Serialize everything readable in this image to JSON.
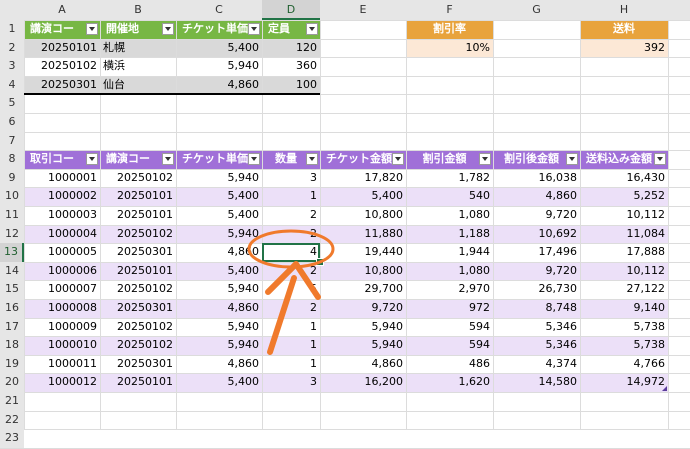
{
  "columns": [
    "A",
    "B",
    "C",
    "D",
    "E",
    "F",
    "G",
    "H"
  ],
  "rows": [
    "1",
    "2",
    "3",
    "4",
    "5",
    "6",
    "7",
    "8",
    "9",
    "10",
    "11",
    "12",
    "13",
    "14",
    "15",
    "16",
    "17",
    "18",
    "19",
    "20",
    "21",
    "22",
    "23"
  ],
  "colors": {
    "green_header": "#77b744",
    "gray_band": "#d9d9d9",
    "purple_header": "#a070d8",
    "purple_band": "#ece0f8",
    "orange_header": "#e8a33c",
    "peach_fill": "#fce8d6",
    "annotation": "#f07a2c",
    "selection": "#217346"
  },
  "table_top": {
    "headers": [
      "講演コー",
      "開催地",
      "チケット単価",
      "定員"
    ],
    "rows": [
      [
        "20250101",
        "札幌",
        "5,400",
        "120"
      ],
      [
        "20250102",
        "横浜",
        "5,940",
        "360"
      ],
      [
        "20250301",
        "仙台",
        "4,860",
        "100"
      ]
    ]
  },
  "discount": {
    "label": "割引率",
    "value": "10%"
  },
  "shipping": {
    "label": "送料",
    "value": "392"
  },
  "table_main": {
    "headers": [
      "取引コー",
      "講演コー",
      "チケット単価",
      "数量",
      "チケット金額",
      "割引金額",
      "割引後金額",
      "送料込み金額"
    ],
    "rows": [
      [
        "1000001",
        "20250102",
        "5,940",
        "3",
        "17,820",
        "1,782",
        "16,038",
        "16,430"
      ],
      [
        "1000002",
        "20250101",
        "5,400",
        "1",
        "5,400",
        "540",
        "4,860",
        "5,252"
      ],
      [
        "1000003",
        "20250101",
        "5,400",
        "2",
        "10,800",
        "1,080",
        "9,720",
        "10,112"
      ],
      [
        "1000004",
        "20250102",
        "5,940",
        "2",
        "11,880",
        "1,188",
        "10,692",
        "11,084"
      ],
      [
        "1000005",
        "20250301",
        "4,860",
        "4",
        "19,440",
        "1,944",
        "17,496",
        "17,888"
      ],
      [
        "1000006",
        "20250101",
        "5,400",
        "2",
        "10,800",
        "1,080",
        "9,720",
        "10,112"
      ],
      [
        "1000007",
        "20250102",
        "5,940",
        "5",
        "29,700",
        "2,970",
        "26,730",
        "27,122"
      ],
      [
        "1000008",
        "20250301",
        "4,860",
        "2",
        "9,720",
        "972",
        "8,748",
        "9,140"
      ],
      [
        "1000009",
        "20250102",
        "5,940",
        "1",
        "5,940",
        "594",
        "5,346",
        "5,738"
      ],
      [
        "1000010",
        "20250102",
        "5,940",
        "1",
        "5,940",
        "594",
        "5,346",
        "5,738"
      ],
      [
        "1000011",
        "20250301",
        "4,860",
        "1",
        "4,860",
        "486",
        "4,374",
        "4,766"
      ],
      [
        "1000012",
        "20250101",
        "5,400",
        "3",
        "16,200",
        "1,620",
        "14,580",
        "14,972"
      ]
    ]
  },
  "selected_cell": "D13"
}
